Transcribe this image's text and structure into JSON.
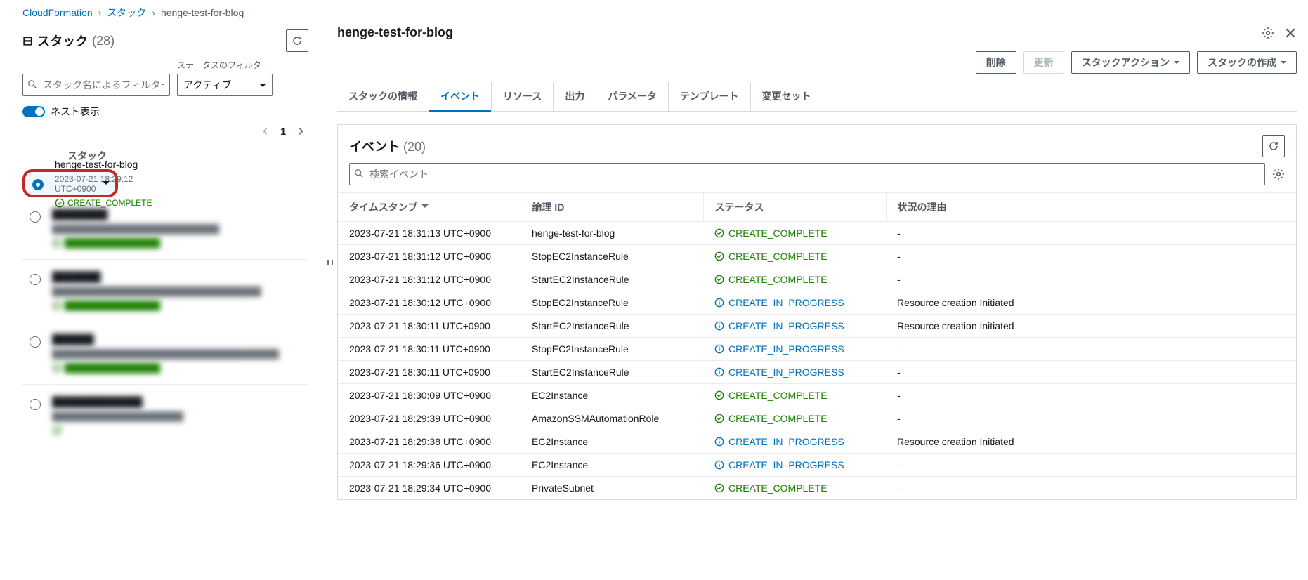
{
  "breadcrumb": {
    "a": "CloudFormation",
    "b": "スタック",
    "c": "henge-test-for-blog"
  },
  "left": {
    "title": "スタック",
    "count": "(28)",
    "search_ph": "スタック名によるフィルター",
    "status_label": "ステータスのフィルター",
    "status_val": "アクティブ",
    "nest": "ネスト表示",
    "col": "スタック",
    "page": "1",
    "items": [
      {
        "name": "henge-test-for-blog",
        "ts": "2023-07-21 18:29:12 UTC+0900",
        "status": "CREATE_COMPLETE",
        "sel": true
      },
      {
        "name": "████████",
        "ts": "████████████████████████████",
        "status": "████████████████",
        "sel": false
      },
      {
        "name": "███████",
        "ts": "███████████████████████████████████",
        "status": "████████████████",
        "sel": false
      },
      {
        "name": "██████",
        "ts": "██████████████████████████████████████",
        "status": "████████████████",
        "sel": false
      },
      {
        "name": "█████████████",
        "ts": "██████████████████████",
        "status": "",
        "sel": false
      }
    ]
  },
  "right": {
    "title": "henge-test-for-blog",
    "btn_delete": "削除",
    "btn_update": "更新",
    "btn_actions": "スタックアクション",
    "btn_create": "スタックの作成",
    "tabs": [
      "スタックの情報",
      "イベント",
      "リソース",
      "出力",
      "パラメータ",
      "テンプレート",
      "変更セット"
    ],
    "active_tab": 1,
    "events_title": "イベント",
    "events_count": "(20)",
    "search_ph": "検索イベント",
    "cols": [
      "タイムスタンプ",
      "論理 ID",
      "ステータス",
      "状況の理由"
    ],
    "rows": [
      {
        "ts": "2023-07-21 18:31:13 UTC+0900",
        "id": "henge-test-for-blog",
        "st": "CREATE_COMPLETE",
        "sk": "ok",
        "rs": "-"
      },
      {
        "ts": "2023-07-21 18:31:12 UTC+0900",
        "id": "StopEC2InstanceRule",
        "st": "CREATE_COMPLETE",
        "sk": "ok",
        "rs": "-"
      },
      {
        "ts": "2023-07-21 18:31:12 UTC+0900",
        "id": "StartEC2InstanceRule",
        "st": "CREATE_COMPLETE",
        "sk": "ok",
        "rs": "-"
      },
      {
        "ts": "2023-07-21 18:30:12 UTC+0900",
        "id": "StopEC2InstanceRule",
        "st": "CREATE_IN_PROGRESS",
        "sk": "prog",
        "rs": "Resource creation Initiated"
      },
      {
        "ts": "2023-07-21 18:30:11 UTC+0900",
        "id": "StartEC2InstanceRule",
        "st": "CREATE_IN_PROGRESS",
        "sk": "prog",
        "rs": "Resource creation Initiated"
      },
      {
        "ts": "2023-07-21 18:30:11 UTC+0900",
        "id": "StopEC2InstanceRule",
        "st": "CREATE_IN_PROGRESS",
        "sk": "prog",
        "rs": "-"
      },
      {
        "ts": "2023-07-21 18:30:11 UTC+0900",
        "id": "StartEC2InstanceRule",
        "st": "CREATE_IN_PROGRESS",
        "sk": "prog",
        "rs": "-"
      },
      {
        "ts": "2023-07-21 18:30:09 UTC+0900",
        "id": "EC2Instance",
        "st": "CREATE_COMPLETE",
        "sk": "ok",
        "rs": "-"
      },
      {
        "ts": "2023-07-21 18:29:39 UTC+0900",
        "id": "AmazonSSMAutomationRole",
        "st": "CREATE_COMPLETE",
        "sk": "ok",
        "rs": "-"
      },
      {
        "ts": "2023-07-21 18:29:38 UTC+0900",
        "id": "EC2Instance",
        "st": "CREATE_IN_PROGRESS",
        "sk": "prog",
        "rs": "Resource creation Initiated"
      },
      {
        "ts": "2023-07-21 18:29:36 UTC+0900",
        "id": "EC2Instance",
        "st": "CREATE_IN_PROGRESS",
        "sk": "prog",
        "rs": "-"
      },
      {
        "ts": "2023-07-21 18:29:34 UTC+0900",
        "id": "PrivateSubnet",
        "st": "CREATE_COMPLETE",
        "sk": "ok",
        "rs": "-"
      }
    ]
  }
}
